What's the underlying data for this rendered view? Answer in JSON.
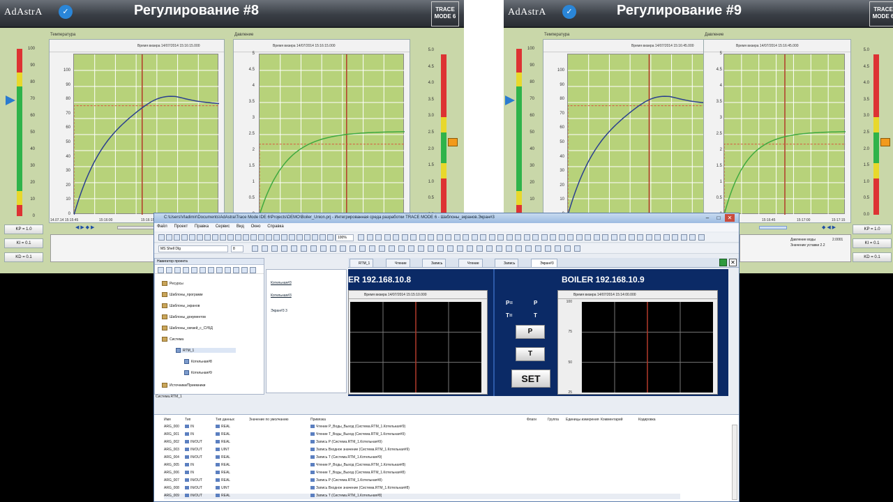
{
  "panel8": {
    "logo": "AdAstrA",
    "title": "Регулирование #8",
    "badge": "TRACE MODE 6",
    "trend_temp": {
      "name": "Температура",
      "info": "Время визира 14/07/2014 15:16:15.000",
      "yticks": [
        "100",
        "90",
        "80",
        "70",
        "60",
        "50",
        "40",
        "30",
        "20",
        "10",
        "0"
      ],
      "xticks": [
        "14.07.14 15:15:45",
        "15:16:00",
        "15:16:15"
      ]
    },
    "trend_press": {
      "name": "Давление",
      "info": "Время визира 14/07/2014 15:16:15.000",
      "yticks": [
        "5",
        "4.5",
        "4",
        "3.5",
        "3",
        "2.5",
        "2",
        "1.5",
        "1",
        "0.5",
        "0"
      ]
    },
    "gauge_left_ticks": [
      "100",
      "90",
      "80",
      "70",
      "60",
      "50",
      "40",
      "30",
      "20",
      "10",
      "0"
    ],
    "gauge_right_ticks": [
      "5.0",
      "4.5",
      "4.0",
      "3.5",
      "3.0",
      "2.5",
      "2.0",
      "1.5",
      "1.0",
      "0.5",
      "0.0"
    ],
    "buttons": [
      "KP = 1.0",
      "KI = 0.1",
      "KD = 0.1"
    ]
  },
  "panel9": {
    "logo": "AdAstrA",
    "title": "Регулирование #9",
    "badge": "TRACE MODE 6",
    "trend_temp": {
      "name": "Температура",
      "info": "Время визира 14/07/2014 15:16:45.000",
      "yticks": [
        "100",
        "90",
        "80",
        "70",
        "60",
        "50",
        "40",
        "30",
        "20",
        "10",
        "0"
      ]
    },
    "trend_press": {
      "name": "Давление",
      "info": "Время визира 14/07/2014 15:16:45.000",
      "yticks": [
        "5",
        "4.5",
        "4",
        "3.5",
        "3",
        "2.5",
        "2",
        "1.5",
        "1",
        "0.5",
        "0"
      ],
      "xticks": [
        "15:16:45",
        "15:17:00",
        "15:17:15"
      ]
    },
    "gauge_left_ticks": [
      "100",
      "90",
      "80",
      "70",
      "60",
      "50",
      "40",
      "30",
      "20",
      "10",
      "0"
    ],
    "gauge_right_ticks": [
      "5.0",
      "4.5",
      "4.0",
      "3.5",
      "3.0",
      "2.5",
      "2.0",
      "1.5",
      "1.0",
      "0.5",
      "0.0"
    ],
    "buttons": [
      "KP = 1.0",
      "KI = 0.1",
      "KD = 0.1"
    ],
    "legend": [
      "Давление воды",
      "Значение уставки 2.2"
    ],
    "legend_value": "2.0001"
  },
  "ide": {
    "title": "C:\\Users\\Vladimir\\Documents\\AdAstra\\Trace Mode IDE 6\\Projects\\DEMO\\Boiler_Union.prj - Интегрированная среда разработки TRACE MODE 6 - Шаблоны_экранов.Экран#3",
    "menu": [
      "Файл",
      "Проект",
      "Правка",
      "Сервис",
      "Вид",
      "Окно",
      "Справка"
    ],
    "font_name": "MS Shell Dlg",
    "font_size": "8",
    "zoom": "100%",
    "nav": {
      "header": "Навигатор проекта",
      "items": [
        "Ресурсы",
        "Шаблоны_программ",
        "Шаблоны_экранов",
        "Шаблоны_документов",
        "Шаблоны_связей_с_СУБД",
        "Система",
        "RTM_1",
        "Котельная#8",
        "Котельная#9",
        "Источники/Приемники"
      ],
      "status": "Система.RTM_1"
    },
    "list": [
      "Котельная#3",
      "Котельная#3",
      "Экран#3 3"
    ],
    "tabs": [
      "RTM_1",
      "Чтение",
      "Запись",
      "Чтение",
      "Запись",
      "Экран#3"
    ],
    "mnemo": {
      "title_left": "ER 192.168.10.8",
      "title_right": "BOILER 192.168.10.9",
      "trend_info_left": "Время визира 14/07/2014 15:15:10.000",
      "trend_info_right": "Время визира 14/07/2014 15:14:00.000",
      "p_label": "P=",
      "p_value": "P",
      "t_label": "T=",
      "t_value": "T",
      "btn_p": "P",
      "btn_t": "T",
      "btn_set": "SET",
      "yticks": [
        "100",
        "75",
        "50",
        "25"
      ]
    },
    "grid": {
      "columns": [
        "Имя",
        "Тип",
        "Тип данных",
        "Значение по умолчанию",
        "Привязка",
        "Флаги",
        "Группа",
        "Единицы измерения",
        "Комментарий",
        "Кодировка"
      ],
      "rows": [
        {
          "name": "ARG_000",
          "type": "IN",
          "dtype": "REAL",
          "bind": "Чтение P_Воды_Выход (Система.RTM_1.Котельная#9)"
        },
        {
          "name": "ARG_001",
          "type": "IN",
          "dtype": "REAL",
          "bind": "Чтение T_Воды_Выход (Система.RTM_1.Котельная#9)"
        },
        {
          "name": "ARG_002",
          "type": "IN/OUT",
          "dtype": "REAL",
          "bind": "Запись P (Система.RTM_1.Котельная#9)"
        },
        {
          "name": "ARG_003",
          "type": "IN/OUT",
          "dtype": "UINT",
          "bind": "Запись Входное значение (Система.RTM_1.Котельная#9)"
        },
        {
          "name": "ARG_004",
          "type": "IN/OUT",
          "dtype": "REAL",
          "bind": "Запись T (Система.RTM_1.Котельная#9)"
        },
        {
          "name": "ARG_005",
          "type": "IN",
          "dtype": "REAL",
          "bind": "Чтение P_Воды_Выход (Система.RTM_1.Котельная#8)"
        },
        {
          "name": "ARG_006",
          "type": "IN",
          "dtype": "REAL",
          "bind": "Чтение T_Воды_Выход (Система.RTM_1.Котельная#8)"
        },
        {
          "name": "ARG_007",
          "type": "IN/OUT",
          "dtype": "REAL",
          "bind": "Запись P (Система.RTM_1.Котельная#8)"
        },
        {
          "name": "ARG_008",
          "type": "IN/OUT",
          "dtype": "UINT",
          "bind": "Запись Входное значение (Система.RTM_1.Котельная#8)"
        },
        {
          "name": "ARG_009",
          "type": "IN/OUT",
          "dtype": "REAL",
          "bind": "Запись T (Система.RTM_1.Котельная#8)"
        }
      ]
    }
  },
  "colors": {
    "panel_bg": "#c9d7a9",
    "plot_bg": "#b7d27a",
    "temp_curve": "#2a3f8f",
    "press_curve": "#3fa93f",
    "setpoint": "#d9533c",
    "cursor": "#b33a2a",
    "mnemo_bg": "#0b2a66"
  }
}
